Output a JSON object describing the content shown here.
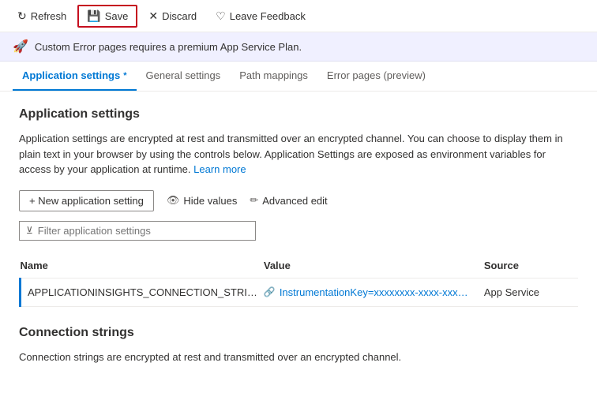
{
  "toolbar": {
    "refresh_label": "Refresh",
    "save_label": "Save",
    "discard_label": "Discard",
    "leave_feedback_label": "Leave Feedback"
  },
  "banner": {
    "text": "Custom Error pages requires a premium App Service Plan."
  },
  "tabs": [
    {
      "id": "app-settings",
      "label": "Application settings",
      "active": true,
      "asterisk": true
    },
    {
      "id": "general-settings",
      "label": "General settings",
      "active": false,
      "asterisk": false
    },
    {
      "id": "path-mappings",
      "label": "Path mappings",
      "active": false,
      "asterisk": false
    },
    {
      "id": "error-pages",
      "label": "Error pages (preview)",
      "active": false,
      "asterisk": false
    }
  ],
  "main": {
    "section_title": "Application settings",
    "description": "Application settings are encrypted at rest and transmitted over an encrypted channel. You can choose to display them in plain text in your browser by using the controls below. Application Settings are exposed as environment variables for access by your application at runtime.",
    "learn_more_label": "Learn more",
    "actions": {
      "new_label": "+ New application setting",
      "hide_values_label": "Hide values",
      "advanced_edit_label": "Advanced edit"
    },
    "filter_placeholder": "Filter application settings",
    "table": {
      "columns": [
        "Name",
        "Value",
        "Source"
      ],
      "rows": [
        {
          "name": "APPLICATIONINSIGHTS_CONNECTION_STRI…",
          "value": "InstrumentationKey=xxxxxxxx-xxxx-xxx…",
          "source": "App Service",
          "has_link": true
        }
      ]
    },
    "connection_strings": {
      "title": "Connection strings",
      "description": "Connection strings are encrypted at rest and transmitted over an encrypted channel."
    }
  }
}
